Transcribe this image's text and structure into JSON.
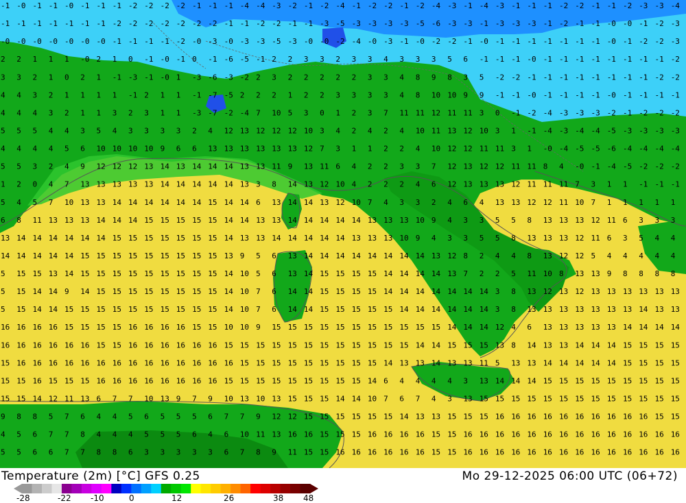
{
  "title": {
    "left": "Temperature (2m) [°C] GFS 0.25",
    "right": "Mo 29-12-2025 06:00 UTC (06+72)"
  },
  "legend": {
    "ticks": [
      "-28",
      "-22",
      "-10",
      "0",
      "12",
      "26",
      "38",
      "48"
    ],
    "colors": [
      "#999999",
      "#b3b3b3",
      "#cccccc",
      "#e6e6e6",
      "#8a0090",
      "#a300b8",
      "#c800e0",
      "#e000ff",
      "#ff00ff",
      "#0000c0",
      "#0030ff",
      "#0070ff",
      "#00a0ff",
      "#00d0ff",
      "#00aa00",
      "#00c800",
      "#00e600",
      "#ffff00",
      "#ffe600",
      "#ffcc00",
      "#ffb000",
      "#ff8c00",
      "#ff6400",
      "#ff0000",
      "#dd0000",
      "#b80000",
      "#960000",
      "#780000",
      "#5a0000"
    ]
  },
  "colors": {
    "sea_warm": "#f0dc40",
    "land": "#12a81a",
    "cold": "#3dd0f8",
    "coast": "#555555"
  },
  "grid_values": [
    "-1 -0 -1 -1 -0 -1 -1 -1 -2 -2 -2 -2 -1 -1 -1 -4 -4 -3 -2 -1 -2 -4 -1 -2 -2 -1 -2 -4 -3 -1 -4 -3 -1 -1 -1 -2 -2 -1 -1 -2 -3 -3 -4",
    "-1 -1 -1 -1 -1 -1 -1 -2 -2 -2 -2 -2 -2 -2 -1 -1 -2 -2 -1 -1 -3 -5 -3 -3 -3 -3 -5 -6 -3 -3 -1 -3 -3 -3 -1 -2 -1 -1 -0 -0 -1 -2 -3",
    "-0 -0 -0 -0 -0 -0 -0 -1 -1 -1 -1 -2 -0 -3 -0 -3 -3 -5 -3 -0 -0 -2 -4 -0 -3 -1 -0 -2 -2 -1 -0 -1 -1 -1 -1 -1 -1 -1 -0 -1 -2 -2 -3",
    "2 2 1 1 1 -0 2 1 0 -1 -0 -1 0 -1 -6 -5 -1 2 2 3 3 2 3 3 4 3 3 3 5 6 -1 -1 -1 -0 -1 -1 -1 -1 -1 -1 -1 -1 -2",
    "3 3 2 1 0 2 1 -1 -3 -1 -0 1 -3 -6 -3 -2 2 3 2 2 2 2 2 3 3 4 8 9 8 3 5 -2 -2 -1 -1 -1 -1 -1 -1 -1 -1 -2 -2",
    "4 4 3 2 1 1 1 1 -1 2 1 1 -1 -7 -5 2 2 2 1 2 2 3 3 3 3 4 8 10 10 9 9 -1 -1 -0 -1 -1 -1 -1 -0 -1 -1 -1 -1",
    "4 4 4 3 2 1 1 3 2 3 1 1 -3 -7 -2 -4 7 10 5 3 0 1 2 3 7 11 11 12 11 11 3 0 -1 -2 -4 -3 -3 -3 -2 -1 -2 -2 -2",
    "5 5 5 4 4 3 5 4 3 3 3 3 2 4 12 13 12 12 12 10 3 4 2 4 2 4 10 11 13 12 10 3 1 -1 -4 -3 -4 -4 -5 -3 -3 -3 -3",
    "4 4 4 4 5 6 10 10 10 10 9 6 6 13 13 13 13 13 13 12 7 3 1 1 2 2 4 10 12 12 11 11 3 1 -0 -4 -5 -5 -6 -4 -4 -4 -4",
    "5 5 3 2 4 9 12 12 12 13 14 13 14 14 14 13 13 11 9 13 11 6 4 2 2 3 3 7 12 13 12 12 11 11 8 4 -0 -1 -4 -5 -2 -2 -2",
    "1 2 0 4 7 13 13 13 13 13 14 14 14 14 14 13 3 8 14 13 12 10 4 2 2 2 4 6 12 13 13 13 12 11 11 11 7 3 1 1 -1 -1 -1",
    "5 4 5 7 10 13 13 14 14 14 14 14 14 15 14 14 6 13 14 14 13 12 10 7 4 3 3 2 4 6 4 13 13 12 12 11 10 7 1 1 1 1 1",
    "6 8 11 13 13 13 14 14 14 15 15 15 15 15 14 14 13 13 14 14 14 14 14 13 13 13 10 9 4 3 3 5 5 8 13 13 13 12 11 6 3 3 3",
    "13 14 14 14 14 14 14 15 15 15 15 15 15 15 14 13 13 14 14 14 14 14 13 13 13 10 9 4 3 3 5 5 8 13 13 13 12 11 6 3 5 4 4",
    "14 14 14 14 14 15 15 15 15 15 15 15 15 15 13 9 5 6 13 14 14 14 14 14 14 14 14 13 12 8 2 4 4 8 13 12 12 5 4 4 4 4 4",
    "5 15 15 13 14 15 15 15 15 15 15 15 15 15 14 10 5 6 13 14 15 15 15 15 14 14 14 14 13 7 2 2 5 11 10 8 13 13 9 8 8 8 8",
    "5 15 14 14 9 14 15 15 15 15 15 15 15 15 14 10 7 6 14 14 15 15 15 15 14 14 14 14 14 14 14 3 8 13 12 13 12 13 13 13 13 13 13",
    "5 15 14 14 15 15 15 15 15 15 15 15 15 15 14 10 7 6 14 14 15 15 15 15 15 14 14 14 14 14 14 3 8 13 13 13 13 13 13 13 14 13 13",
    "16 16 16 16 15 15 15 15 16 16 16 16 15 15 10 10 9 15 15 15 15 15 15 15 15 15 15 15 14 14 14 12 4 6 13 13 13 13 13 14 14 14 14",
    "16 16 16 16 16 16 15 15 16 16 16 16 16 16 15 15 15 15 15 15 15 15 15 15 15 15 14 14 15 15 15 13 8 14 13 13 14 14 14 15 15 15 15",
    "15 16 16 16 16 16 16 16 16 16 16 16 16 16 16 15 15 15 15 15 15 15 15 15 14 13 13 14 13 13 11 5 13 13 14 14 14 14 14 15 15 15 15",
    "15 15 16 15 15 15 16 16 16 16 16 16 16 16 15 15 15 15 15 15 15 15 15 14 6 4 4 4 4 3 13 14 14 14 15 15 15 15 15 15 15 15 15",
    "15 15 14 12 11 13 6 7 7 10 13 9 7 9 10 13 10 13 15 15 15 14 14 10 7 6 7 4 3 13 15 15 15 15 15 15 15 15 15 15 15 15 15",
    "9 8 8 5 7 6 4 4 5 6 5 5 5 6 7 7 9 12 12 15 15 15 15 15 15 14 13 13 15 15 15 16 16 16 16 16 16 16 16 16 16 15 15",
    "4 5 6 7 7 8 4 4 4 5 5 5 6 4 6 10 11 13 16 16 15 15 15 16 16 16 16 15 15 16 16 16 16 16 16 16 16 16 16 16 16 16 16",
    "5 5 6 6 7 7 8 8 6 3 3 3 3 3 6 7 8 9 11 15 15 16 16 16 16 16 16 15 15 16 16 16 16 16 16 16 16 16 16 16 16 16 16"
  ]
}
